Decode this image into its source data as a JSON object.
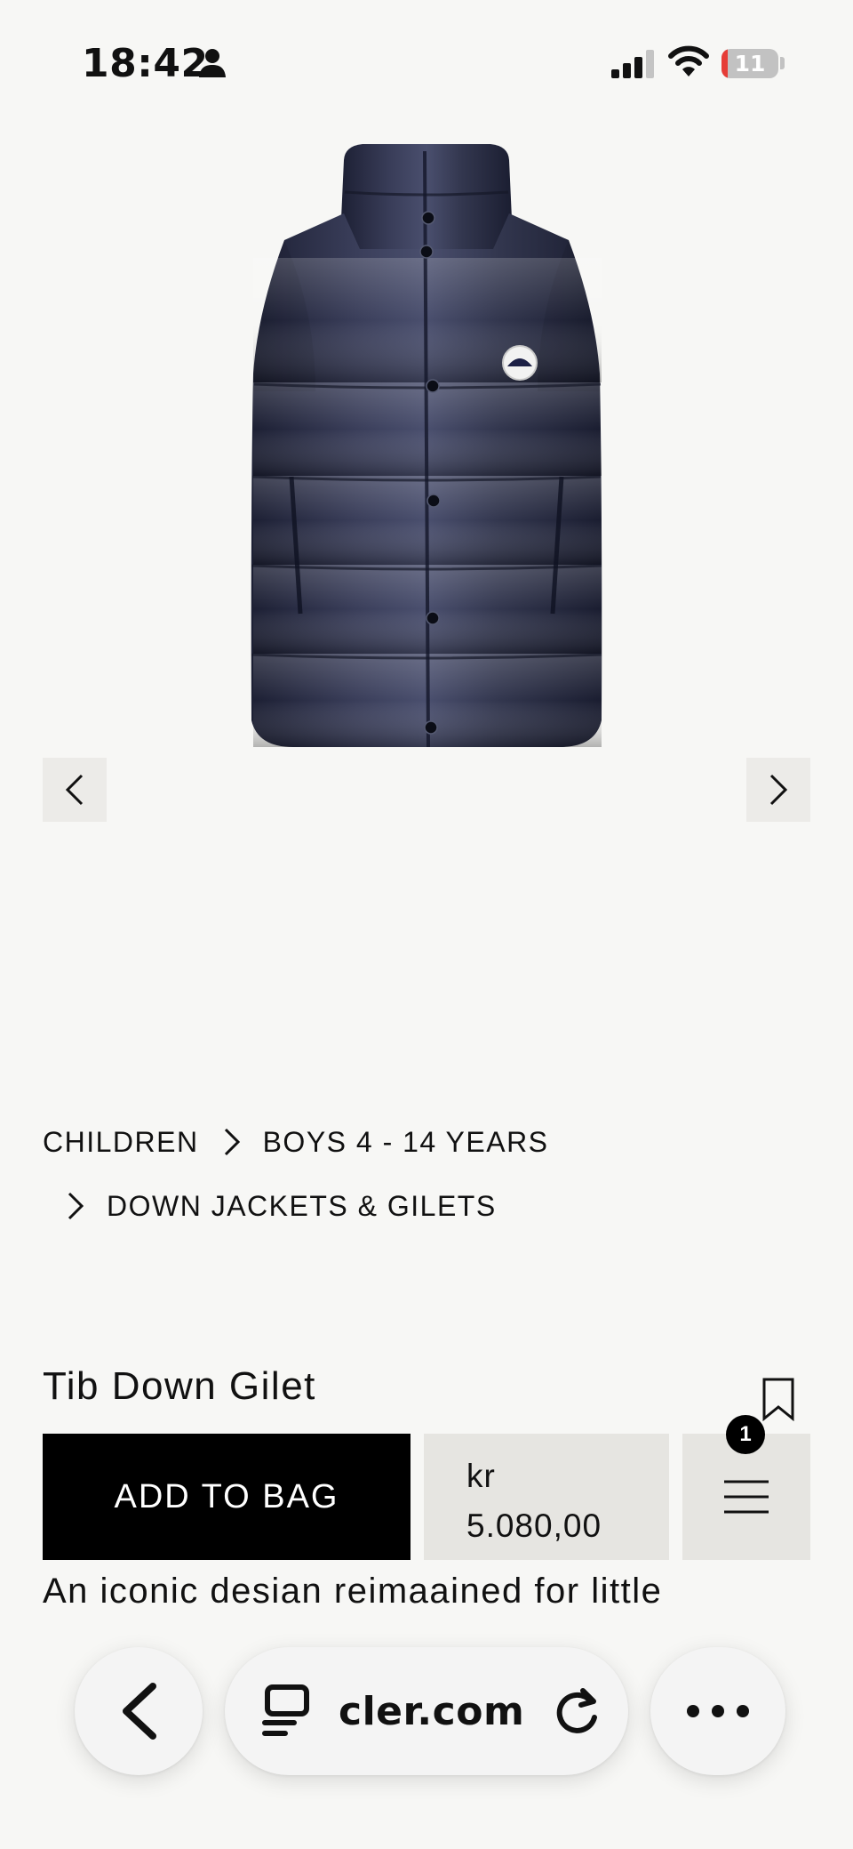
{
  "status_bar": {
    "time": "18:42",
    "battery_level": 11,
    "battery_text": "11",
    "person_icon": "person-icon",
    "signal_icon": "cellular-signal-icon",
    "wifi_icon": "wifi-icon"
  },
  "gallery": {
    "image_icon": "down-gilet-product-image",
    "prev_icon": "chevron-left-icon",
    "next_icon": "chevron-right-icon"
  },
  "breadcrumb": {
    "items": [
      "CHILDREN",
      "BOYS 4 - 14 YEARS",
      "DOWN JACKETS & GILETS"
    ],
    "separator_icon": "chevron-right-icon"
  },
  "product": {
    "title": "Tib Down Gilet",
    "add_to_bag_label": "ADD TO BAG",
    "price_currency": "kr",
    "price_value": "5.080,00",
    "menu_badge_count": "1",
    "description": "An iconic desian reimaained for little",
    "wishlist_icon": "bookmark-icon",
    "menu_icon": "hamburger-menu-icon"
  },
  "browser": {
    "url": "cler.com",
    "back_icon": "back-chevron-icon",
    "tabs_icon": "reader-tabs-icon",
    "reload_icon": "reload-icon",
    "more_icon": "more-dots-icon"
  },
  "colors": {
    "background": "#f7f7f5",
    "button_black": "#000000",
    "panel_gray": "#e6e5e1",
    "battery_low": "#e63d37",
    "gilet_navy": "#2a2d45"
  }
}
